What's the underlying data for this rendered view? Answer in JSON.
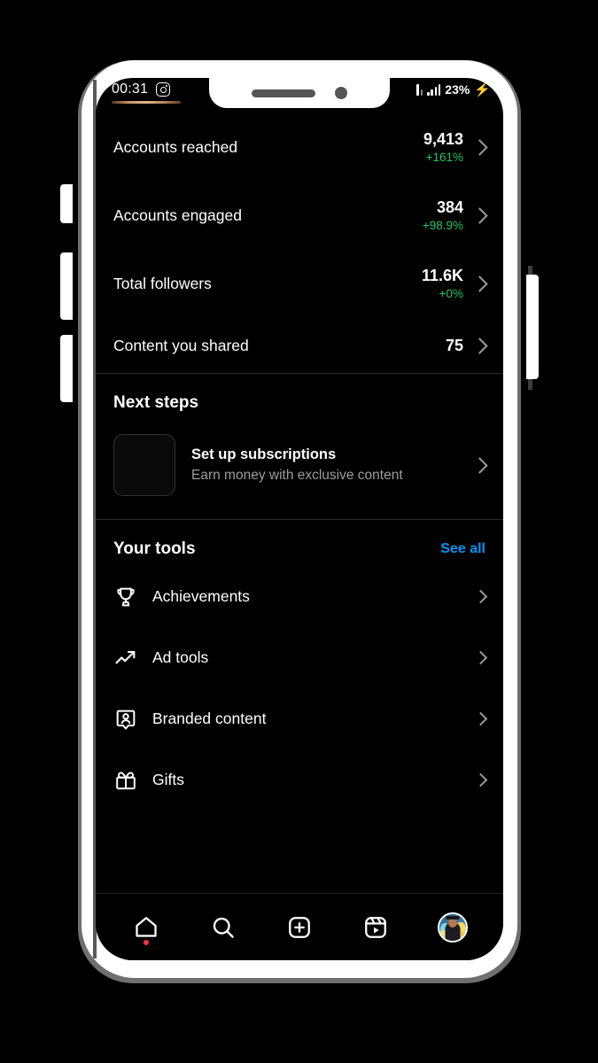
{
  "status_bar": {
    "time": "00:31",
    "app_icon": "instagram-camera-icon",
    "battery_percent": "23%",
    "charging_icon": "lightning-bolt-icon",
    "signal_icon": "signal-bars-icon"
  },
  "insights": {
    "rows": [
      {
        "label": "Accounts reached",
        "value": "9,413",
        "delta": "+161%",
        "delta_color": "#1fc767"
      },
      {
        "label": "Accounts engaged",
        "value": "384",
        "delta": "+98.9%",
        "delta_color": "#1fc767"
      },
      {
        "label": "Total followers",
        "value": "11.6K",
        "delta": "+0%",
        "delta_color": "#1fc767"
      },
      {
        "label": "Content you shared",
        "value": "75",
        "delta": "",
        "delta_color": "#1fc767"
      }
    ]
  },
  "next_steps": {
    "title": "Next steps",
    "card": {
      "title": "Set up subscriptions",
      "subtitle": "Earn money with exclusive content",
      "thumbnail": "empty-thumbnail"
    }
  },
  "your_tools": {
    "title": "Your tools",
    "see_all_label": "See all",
    "see_all_color": "#0095f6",
    "items": [
      {
        "label": "Achievements",
        "icon": "trophy-icon"
      },
      {
        "label": "Ad tools",
        "icon": "trending-up-icon"
      },
      {
        "label": "Branded content",
        "icon": "person-badge-icon"
      },
      {
        "label": "Gifts",
        "icon": "gift-icon"
      }
    ]
  },
  "bottom_nav": {
    "items": [
      {
        "name": "home",
        "icon": "home-icon",
        "has_badge": true
      },
      {
        "name": "search",
        "icon": "search-icon",
        "has_badge": false
      },
      {
        "name": "create",
        "icon": "plus-square-icon",
        "has_badge": false
      },
      {
        "name": "reels",
        "icon": "reels-icon",
        "has_badge": false
      },
      {
        "name": "profile",
        "icon": "avatar-icon",
        "has_badge": false
      }
    ],
    "badge_color": "#ff3040"
  },
  "theme": {
    "background": "#000000",
    "text": "#ffffff",
    "muted_text": "#9d9d9d",
    "divider": "#2a2a2a",
    "accent_blue": "#0095f6",
    "accent_green": "#1fc767",
    "phone_body": "#ffffff"
  }
}
